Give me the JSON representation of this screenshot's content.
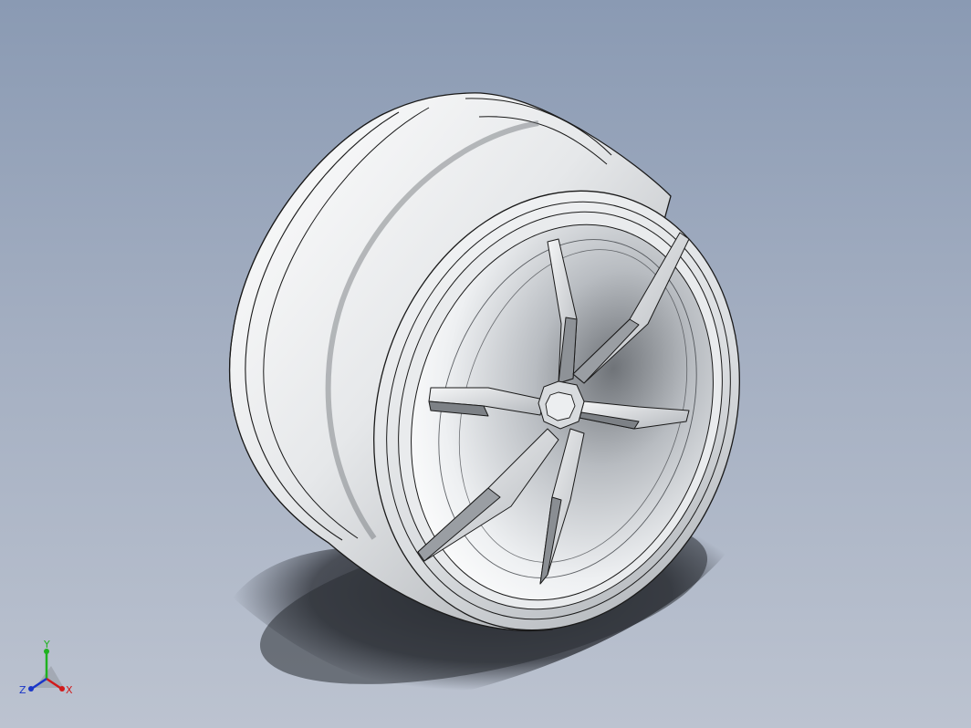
{
  "viewport": {
    "model": "wheel-rim",
    "colors": {
      "background_top": "#8a9ab3",
      "background_bottom": "#bcc3d0",
      "model_light": "#f4f5f6",
      "model_mid": "#cfd3d7",
      "model_dark": "#8d9196",
      "edge": "#1a1a1a",
      "shadow": "#2a2d33"
    }
  },
  "triad": {
    "x_label": "X",
    "y_label": "Y",
    "z_label": "Z",
    "x_color": "#d11a1a",
    "y_color": "#1fb21f",
    "z_color": "#1a36c8"
  }
}
